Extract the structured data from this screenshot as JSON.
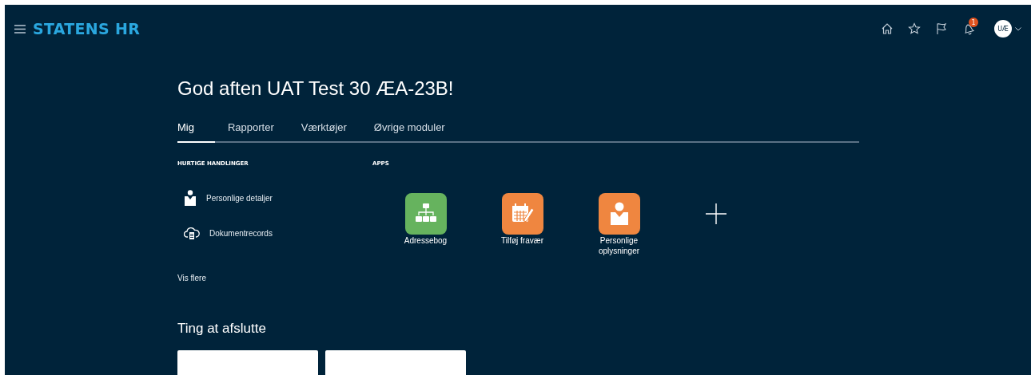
{
  "header": {
    "brand": "STATENS HR",
    "notification_count": "1",
    "avatar": "UÆ"
  },
  "greeting": "God aften UAT Test 30 ÆA-23B!",
  "tabs": [
    {
      "label": "Mig",
      "selected": true
    },
    {
      "label": "Rapporter",
      "selected": false
    },
    {
      "label": "Værktøjer",
      "selected": false
    },
    {
      "label": "Øvrige moduler",
      "selected": false
    }
  ],
  "quick_actions": {
    "heading": "HURTIGE HANDLINGER",
    "items": [
      {
        "label": "Personlige detaljer",
        "kind": "person"
      },
      {
        "label": "Dokumentrecords",
        "kind": "cloud"
      }
    ],
    "more": "Vis flere"
  },
  "apps": {
    "heading": "APPS",
    "items": [
      {
        "label": "Adressebog",
        "kind": "org",
        "color": "#66b35e"
      },
      {
        "label": "Tilføj fravær",
        "kind": "calendar",
        "color": "#ef8640"
      },
      {
        "label": "Personlige oplysninger",
        "kind": "person",
        "color": "#ef8640"
      }
    ]
  },
  "todo": {
    "heading": "Ting at afslutte"
  }
}
